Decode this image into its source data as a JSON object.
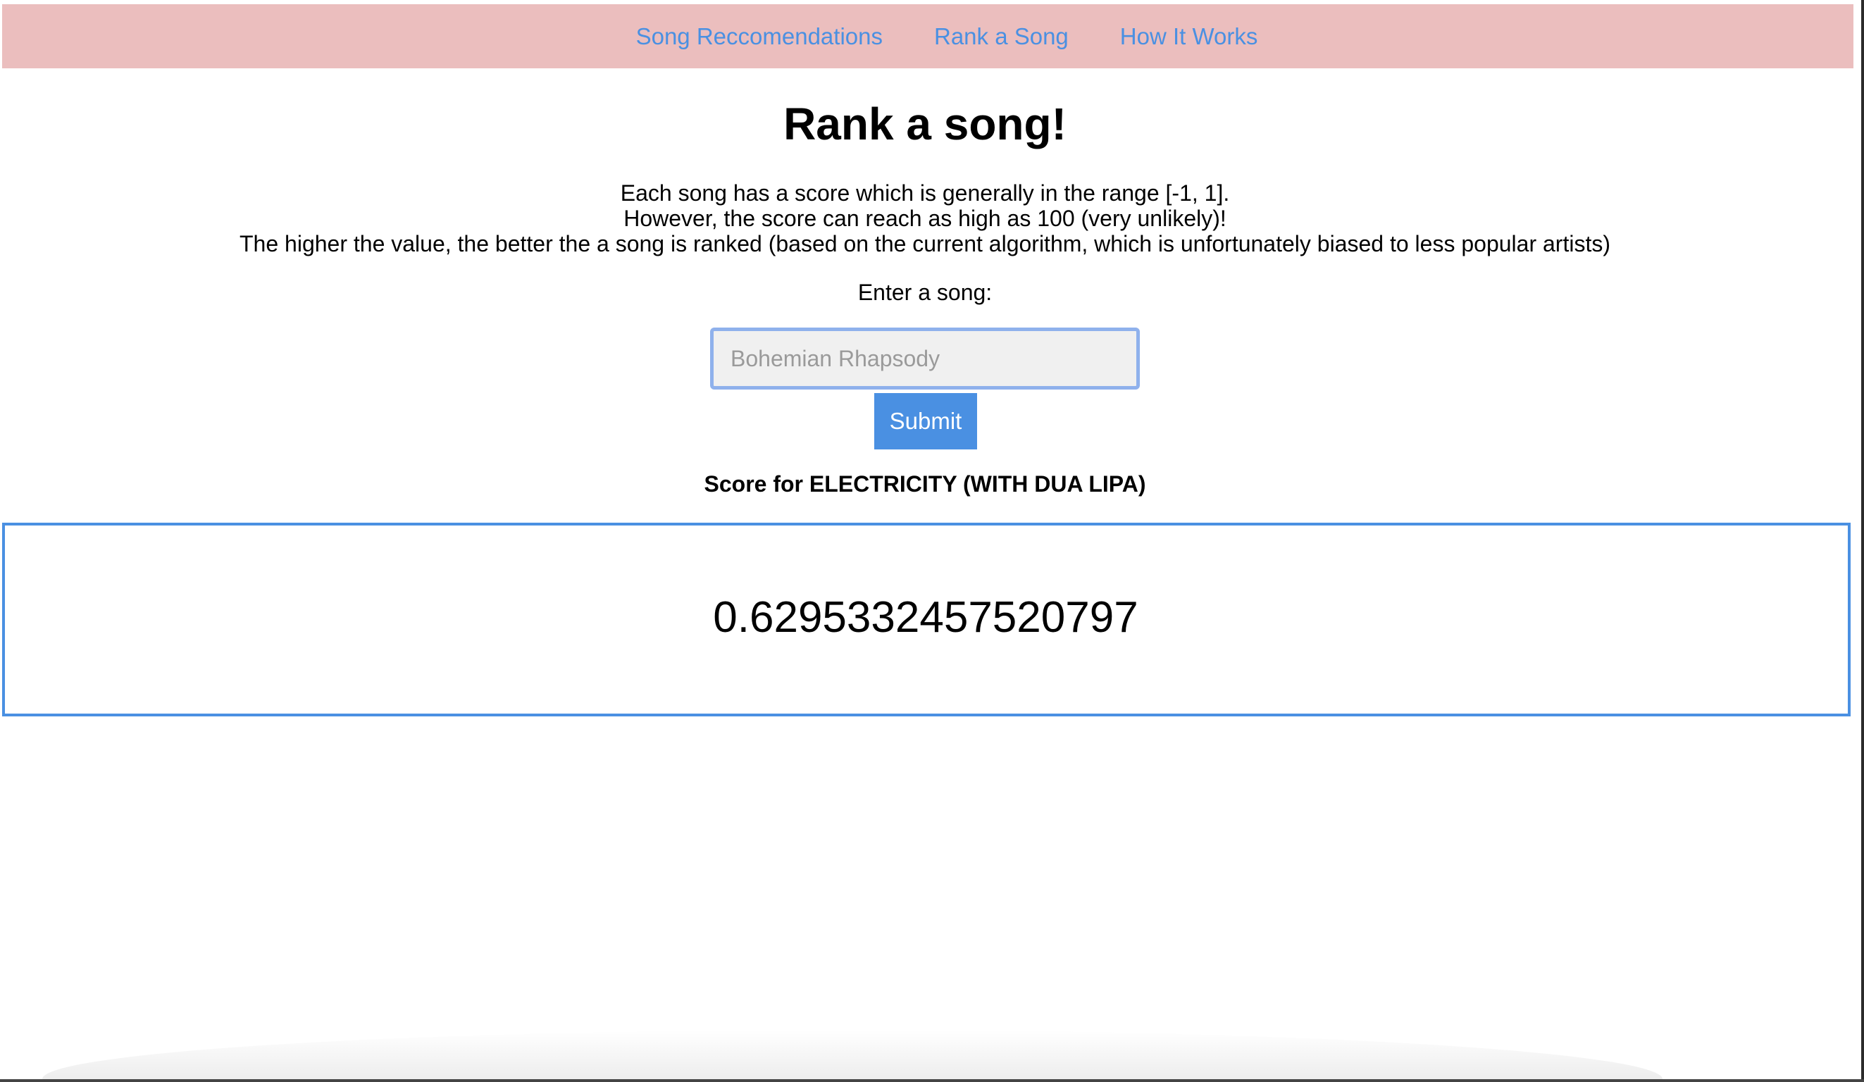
{
  "nav": {
    "items": [
      {
        "label": "Song Reccomendations"
      },
      {
        "label": "Rank a Song"
      },
      {
        "label": "How It Works"
      }
    ]
  },
  "main": {
    "title": "Rank a song!",
    "description": [
      "Each song has a score which is generally in the range [-1, 1].",
      "However, the score can reach as high as 100 (very unlikely)!",
      "The higher the value, the better the a song is ranked (based on the current algorithm, which is unfortunately biased to less popular artists)"
    ],
    "input_label": "Enter a song:",
    "input": {
      "value": "",
      "placeholder": "Bohemian Rhapsody"
    },
    "submit_label": "Submit",
    "score_heading": "Score for ELECTRICITY (WITH DUA LIPA)",
    "score_value": "0.6295332457520797"
  },
  "colors": {
    "navbar_bg": "#ebbebe",
    "link": "#4a90e2",
    "button_bg": "#4a90e2",
    "input_border": "#8fb1ec",
    "score_border": "#4a90e2"
  }
}
